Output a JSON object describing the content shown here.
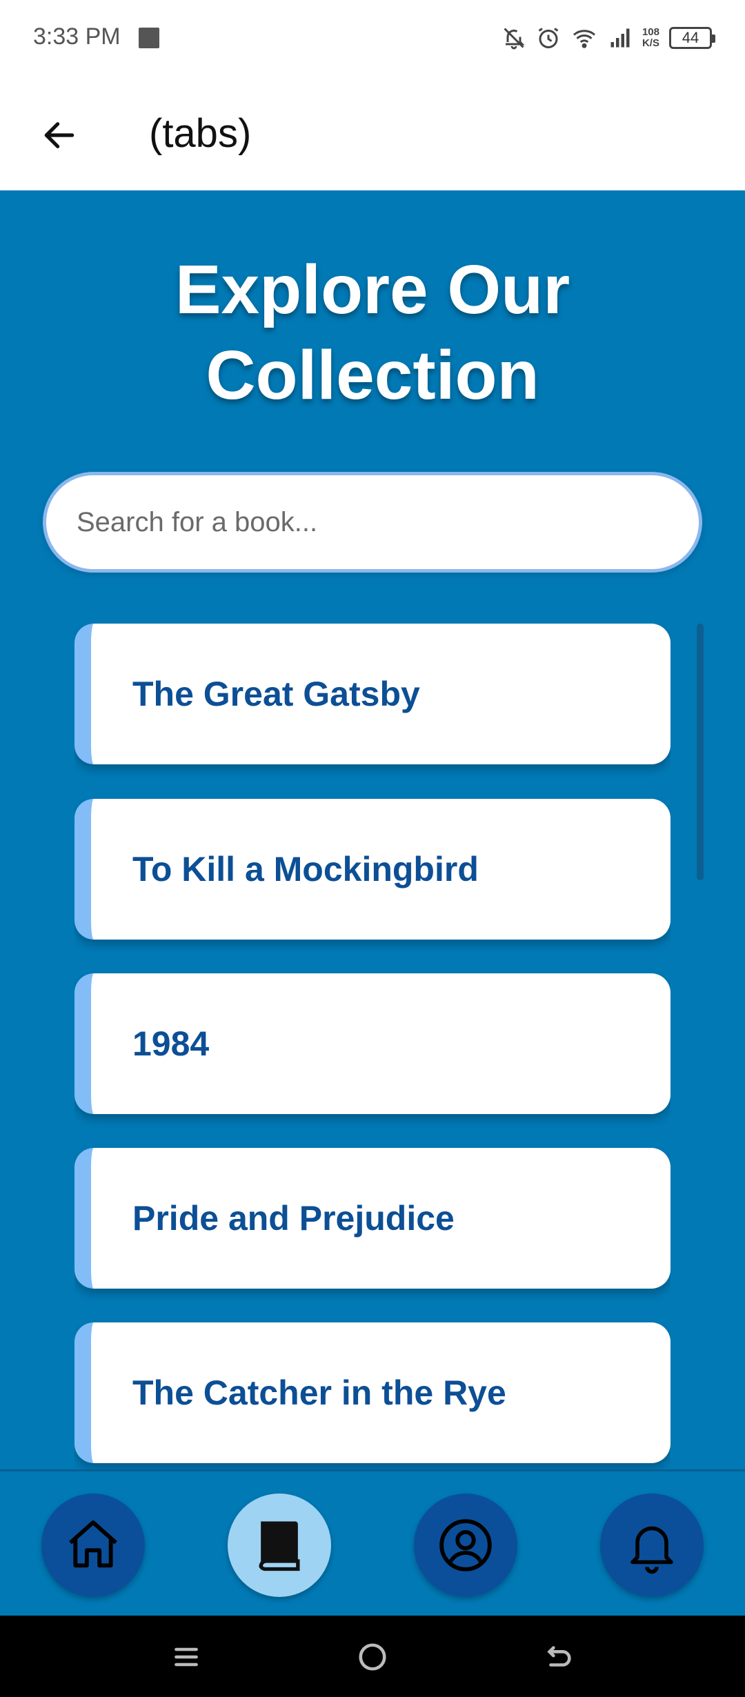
{
  "status_bar": {
    "time": "3:33 PM",
    "network_speed_value": "108",
    "network_speed_unit": "K/S",
    "battery_level": "44",
    "icons": [
      "notifications-off-icon",
      "alarm-icon",
      "wifi-icon",
      "signal-icon",
      "battery-icon"
    ]
  },
  "app_bar": {
    "title": "(tabs)",
    "back_icon": "arrow-left-icon"
  },
  "main": {
    "heading_line1": "Explore Our",
    "heading_line2": "Collection",
    "search": {
      "placeholder": "Search for a book...",
      "value": ""
    },
    "books": [
      {
        "title": "The Great Gatsby"
      },
      {
        "title": "To Kill a Mockingbird"
      },
      {
        "title": "1984"
      },
      {
        "title": "Pride and Prejudice"
      },
      {
        "title": "The Catcher in the Rye"
      }
    ]
  },
  "bottom_nav": {
    "items": [
      {
        "icon": "home-icon",
        "active": false
      },
      {
        "icon": "book-icon",
        "active": true
      },
      {
        "icon": "profile-icon",
        "active": false
      },
      {
        "icon": "bell-icon",
        "active": false
      }
    ]
  },
  "colors": {
    "background": "#0079b5",
    "card_accent": "#82bdf8",
    "book_title": "#0c4f95",
    "nav_button": "#0b4f9a",
    "nav_button_active": "#9fd3f3"
  }
}
